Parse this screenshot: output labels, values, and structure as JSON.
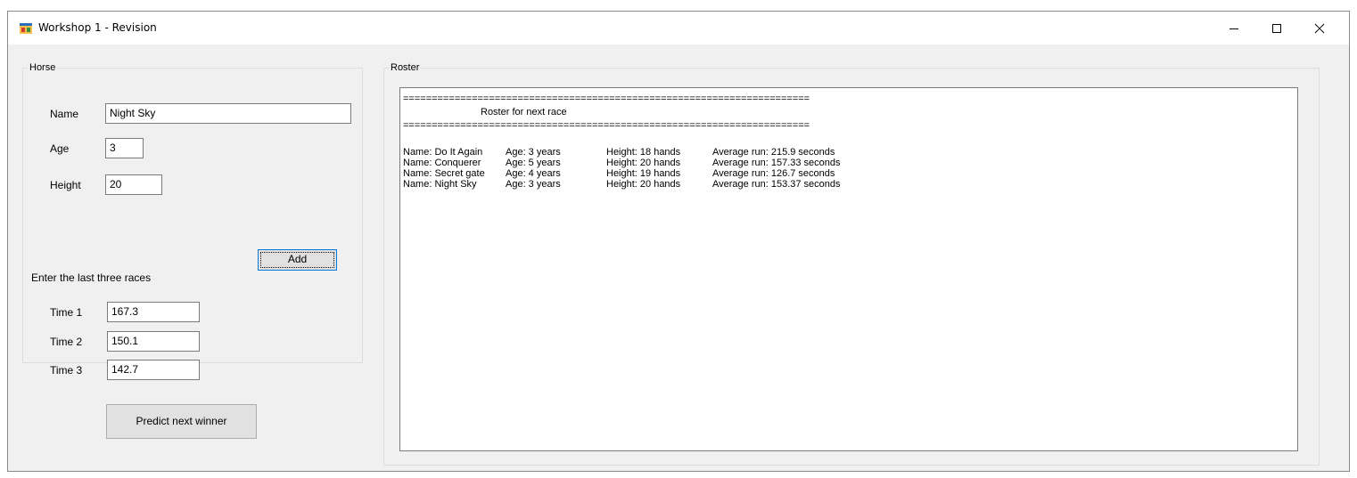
{
  "window": {
    "title": "Workshop 1 - Revision",
    "icon": "winforms-app-icon",
    "controls": [
      "minimize-icon",
      "maximize-icon",
      "close-icon"
    ]
  },
  "horse_group": {
    "legend": "Horse",
    "name_label": "Name",
    "name_value": "Night Sky",
    "age_label": "Age",
    "age_value": "3",
    "height_label": "Height",
    "height_value": "20",
    "add_button": "Add",
    "races_label": "Enter the last three races",
    "time1_label": "Time 1",
    "time1_value": "167.3",
    "time2_label": "Time 2",
    "time2_value": "150.1",
    "time3_label": "Time 3",
    "time3_value": "142.7"
  },
  "predict_button": "Predict next winner",
  "roster_group": {
    "legend": "Roster",
    "separator": "=======================================================================",
    "heading": "Roster for next race",
    "rows": [
      {
        "name": "Name: Do It Again",
        "age": "Age: 3 years",
        "height": "Height: 18 hands",
        "average": "Average run: 215.9 seconds"
      },
      {
        "name": "Name: Conquerer",
        "age": "Age: 5 years",
        "height": "Height: 20 hands",
        "average": "Average run: 157.33 seconds"
      },
      {
        "name": "Name: Secret gate",
        "age": "Age: 4 years",
        "height": "Height: 19 hands",
        "average": "Average run: 126.7 seconds"
      },
      {
        "name": "Name: Night Sky",
        "age": "Age: 3 years",
        "height": "Height: 20 hands",
        "average": "Average run: 153.37 seconds"
      }
    ]
  },
  "colors": {
    "window_bg": "#f0f0f0",
    "focus_border": "#0078d7"
  }
}
